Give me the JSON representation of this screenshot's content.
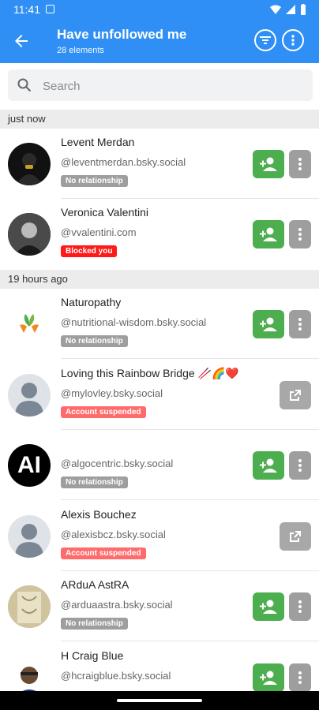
{
  "status": {
    "time": "11:41"
  },
  "header": {
    "title": "Have unfollowed me",
    "subtitle": "28 elements"
  },
  "search": {
    "placeholder": "Search",
    "value": ""
  },
  "sections": [
    {
      "label": "just now"
    },
    {
      "label": "19 hours ago"
    }
  ],
  "users": [
    {
      "name": "Levent Merdan",
      "handle": "@leventmerdan.bsky.social",
      "badge": "No relationship"
    },
    {
      "name": "Veronica Valentini",
      "handle": "@vvalentini.com",
      "badge": "Blocked you"
    },
    {
      "name": "Naturopathy",
      "handle": "@nutritional-wisdom.bsky.social",
      "badge": "No relationship"
    },
    {
      "name": "Loving  this  Rainbow Bridge 🥢🌈❤️",
      "handle": "@mylovley.bsky.social",
      "badge": "Account suspended"
    },
    {
      "name": "",
      "handle": "@algocentric.bsky.social",
      "badge": "No relationship",
      "avatar_text": "AI"
    },
    {
      "name": "Alexis Bouchez",
      "handle": "@alexisbcz.bsky.social",
      "badge": "Account suspended"
    },
    {
      "name": "ARduA AstRA",
      "handle": "@arduaastra.bsky.social",
      "badge": "No relationship"
    },
    {
      "name": "H Craig Blue",
      "handle": "@hcraigblue.bsky.social",
      "badge": ""
    }
  ],
  "colors": {
    "primary": "#2f8ff5",
    "follow_green": "#4cae4f",
    "badge_gray": "#9e9e9e",
    "badge_blocked": "#ff1a1a",
    "badge_suspended": "#ff6b6b"
  },
  "icons": {
    "back": "arrow-left-icon",
    "filter": "filter-icon",
    "more": "more-vertical-icon",
    "search": "search-icon",
    "follow": "person-add-icon",
    "menu": "more-vertical-icon",
    "open": "open-external-icon"
  }
}
